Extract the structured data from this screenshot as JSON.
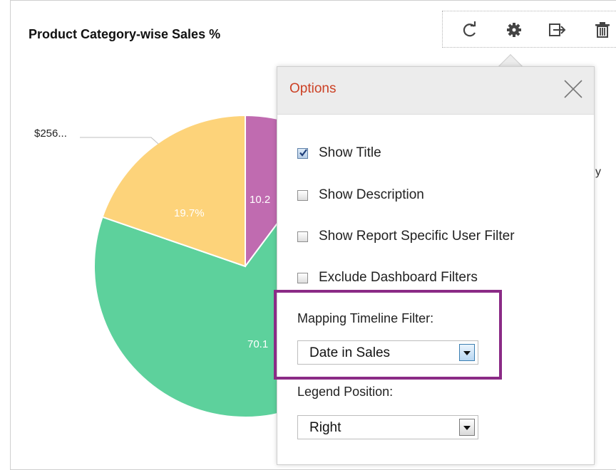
{
  "chart": {
    "title": "Product Category-wise Sales %",
    "outside_label": "$256...",
    "partial_legend_char": "y"
  },
  "chart_data": {
    "type": "pie",
    "title": "Product Category-wise Sales %",
    "slices": [
      {
        "label": "10.2%",
        "value": 10.2,
        "color": "#c06bb0"
      },
      {
        "label": "70.1%",
        "value": 70.1,
        "color": "#5dd19c"
      },
      {
        "label": "19.7%",
        "value": 19.7,
        "color": "#fdd37a"
      }
    ],
    "visible_labels": [
      "10.2",
      "70.1",
      "19.7%"
    ]
  },
  "toolbar": {
    "icons": [
      "refresh-icon",
      "gear-icon",
      "export-icon",
      "trash-icon"
    ]
  },
  "options_panel": {
    "title": "Options",
    "checkboxes": [
      {
        "label": "Show Title",
        "checked": true
      },
      {
        "label": "Show Description",
        "checked": false
      },
      {
        "label": "Show Report Specific User Filter",
        "checked": false
      },
      {
        "label": "Exclude Dashboard Filters",
        "checked": false
      }
    ],
    "mapping_timeline": {
      "label": "Mapping Timeline Filter:",
      "value": "Date in Sales"
    },
    "legend_position": {
      "label": "Legend Position:",
      "value": "Right"
    }
  },
  "colors": {
    "accent_title": "#cc4125",
    "highlight": "#8b2b86",
    "slice_purple": "#c06bb0",
    "slice_green": "#5dd19c",
    "slice_yellow": "#fdd37a"
  }
}
